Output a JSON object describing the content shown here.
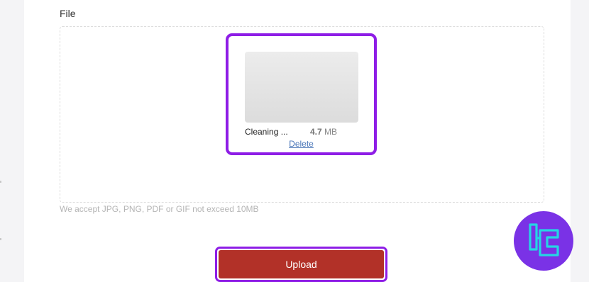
{
  "form": {
    "file_label": "File",
    "hint": "We accept JPG, PNG, PDF or GIF not exceed 10MB",
    "upload_label": "Upload"
  },
  "preview": {
    "file_name": "Cleaning ...",
    "file_size_value": "4.7",
    "file_size_unit": "MB",
    "delete_label": "Delete"
  },
  "colors": {
    "highlight": "#8e1de6",
    "upload_button": "#b23128",
    "link": "#4a76b8",
    "logo_bg": "#7a32e6",
    "logo_stroke": "#25d5e4"
  },
  "icons": {
    "logo": "tc-logo-icon"
  }
}
